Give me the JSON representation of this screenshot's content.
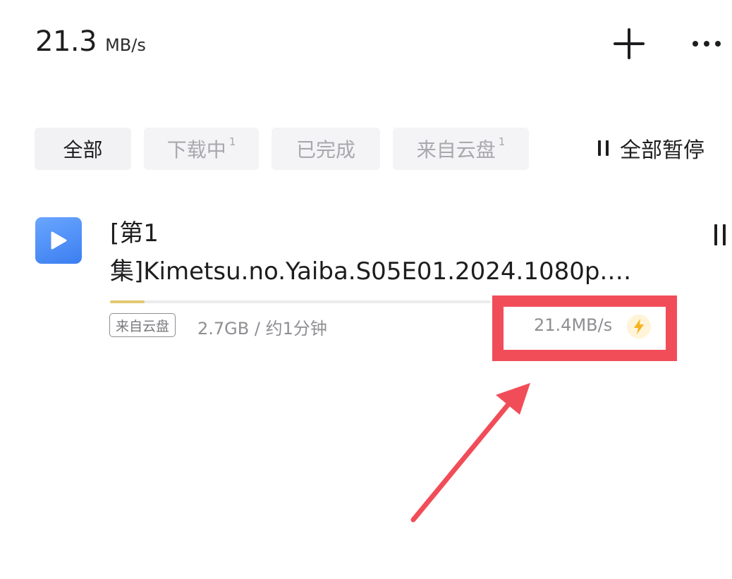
{
  "header": {
    "speed_value": "21.3",
    "speed_unit": "MB/s",
    "add_icon": "plus-icon",
    "more_icon": "more-dots-icon"
  },
  "tabs": [
    {
      "label": "全部",
      "count": "",
      "active": true
    },
    {
      "label": "下载中",
      "count": "1",
      "active": false
    },
    {
      "label": "已完成",
      "count": "",
      "active": false
    },
    {
      "label": "来自云盘",
      "count": "1",
      "active": false
    }
  ],
  "pause_all": {
    "label": "全部暂停",
    "icon": "pause-icon"
  },
  "download": {
    "file_icon": "video-play-icon",
    "name": "[第1\n集]Kimetsu.no.Yaiba.S05E01.2024.1080p.…",
    "progress": 0.09,
    "source_badge": "来自云盘",
    "size_eta": "2.7GB / 约1分钟",
    "speed": "21.4MB/s",
    "boost_icon": "lightning-icon",
    "pause_icon": "pause-icon"
  },
  "colors": {
    "accent_highlight": "#f14d59",
    "progress_fill": "#e3c871",
    "file_icon": "#4a8cf5",
    "bolt": "#f5b41e"
  }
}
